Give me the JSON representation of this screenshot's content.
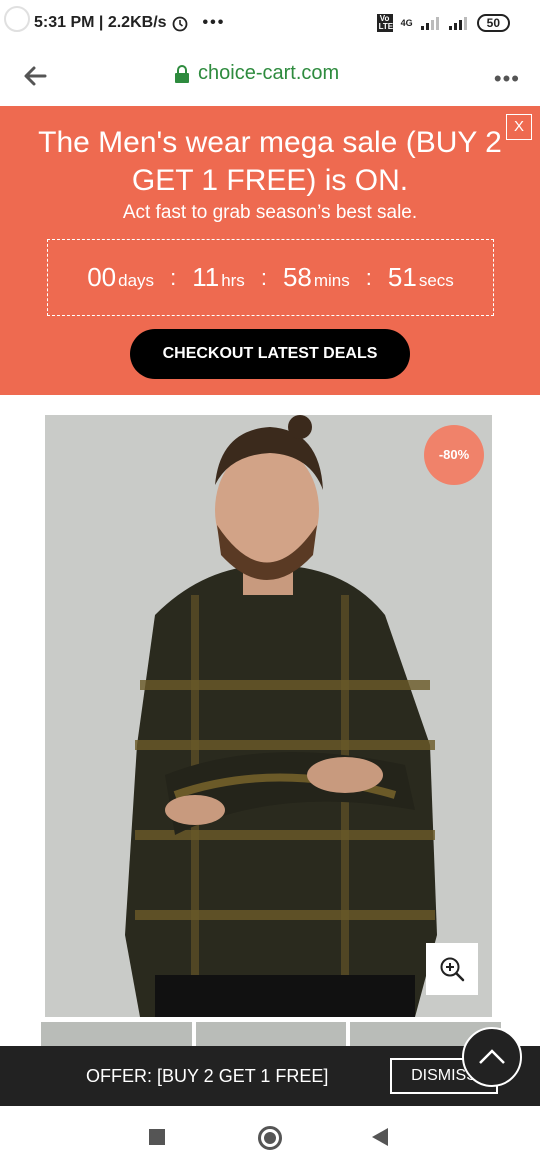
{
  "status_bar": {
    "time_speed": "5:31 PM | 2.2KB/s",
    "alarm_icon": "alarm-clock-icon",
    "more_dots": "•••",
    "volte": "Vo LTE",
    "network": "4G",
    "battery": "50"
  },
  "browser": {
    "url": "choice-cart.com",
    "more_menu": "•••"
  },
  "banner": {
    "background": "#ee6a50",
    "headline": "The Men's wear mega sale (BUY 2 GET 1 FREE) is ON.",
    "subline": "Act fast to grab season’s best sale.",
    "close_label": "X",
    "countdown": {
      "days": "00",
      "days_unit": "days",
      "hrs": "11",
      "hrs_unit": "hrs",
      "mins": "58",
      "mins_unit": "mins",
      "secs": "51",
      "secs_unit": "secs",
      "separator": ":"
    },
    "cta_label": "CHECKOUT LATEST DEALS"
  },
  "product": {
    "discount_badge": "-80%",
    "image_desc": "man-in-dark-checked-shirt",
    "zoom_icon": "zoom-in-icon"
  },
  "offer_bar": {
    "text": "OFFER: [BUY 2 GET 1 FREE]",
    "dismiss_label": "DISMISS"
  }
}
